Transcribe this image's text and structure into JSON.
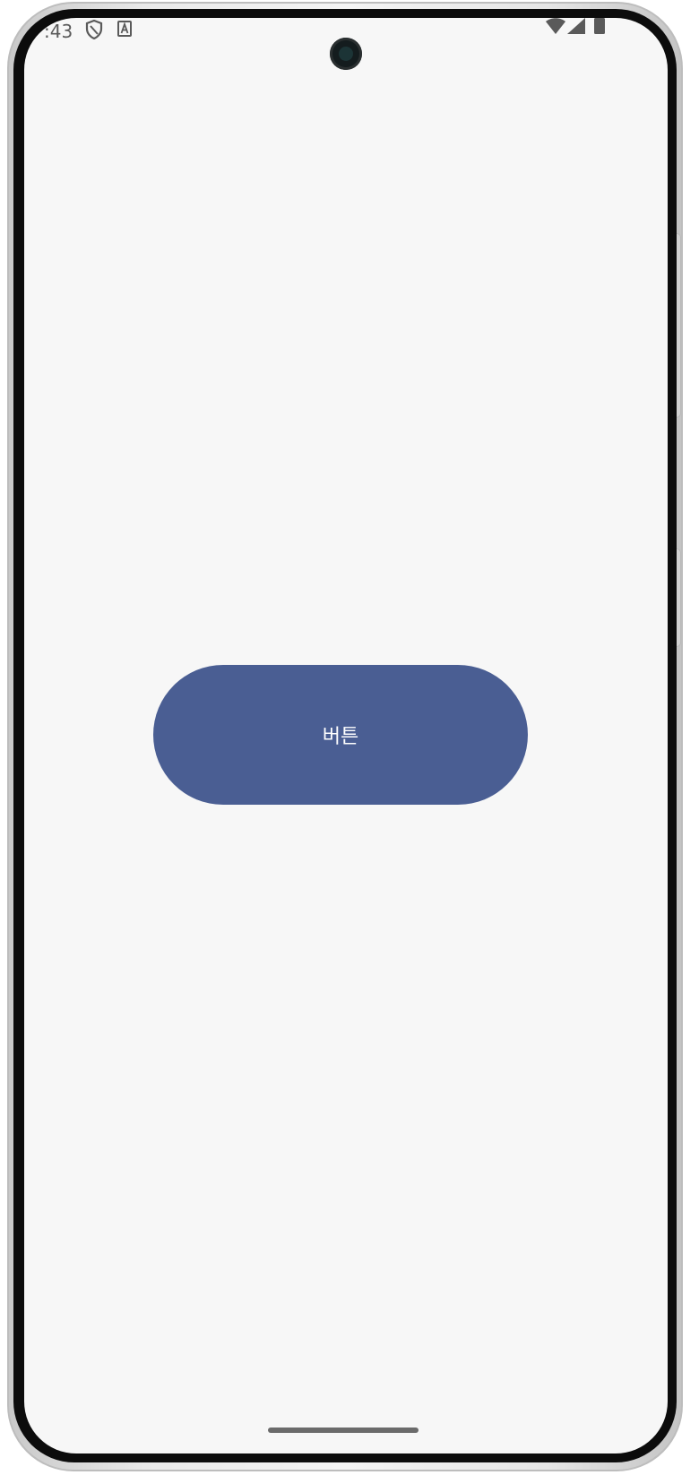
{
  "status_bar": {
    "time": ":43",
    "icons": [
      "shield-icon",
      "keyboard-a-icon",
      "wifi-icon",
      "cell-signal-icon",
      "battery-icon"
    ]
  },
  "main": {
    "button_label": "버튼"
  },
  "colors": {
    "button_bg": "#4a5e93",
    "button_text": "#ffffff",
    "screen_bg": "#f7f7f7"
  }
}
